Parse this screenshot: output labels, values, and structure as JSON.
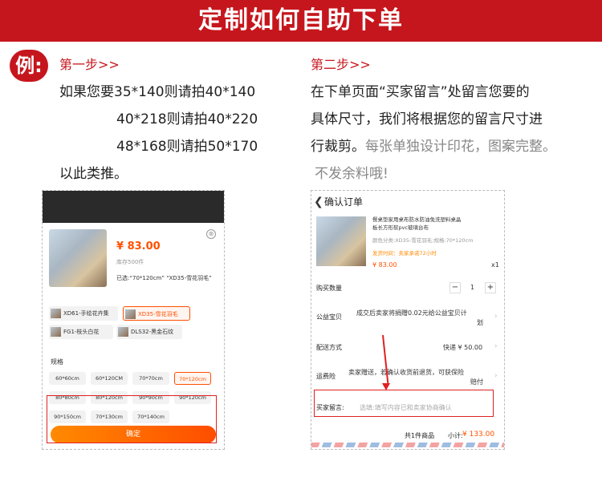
{
  "banner": {
    "title": "定制如何自助下单"
  },
  "example_badge": "例:",
  "step1": {
    "title": "第一步>>",
    "lines": [
      "如果您要35*140则请拍40*140",
      "40*218则请拍40*220",
      "48*168则请拍50*170",
      "以此类推。"
    ]
  },
  "step2": {
    "title": "第二步>>",
    "line1": "在下单页面“买家留言”处留言您要的",
    "line2": "具体尺寸，我们将根据您的留言尺寸进",
    "line3_main": "行裁剪。",
    "line3_grey": "每张单独设计印花，图案完整。",
    "line4": "不发余料哦!"
  },
  "left_phone": {
    "price": "¥ 83.00",
    "stock": "库存500件",
    "selected": "已选:“70*120cm” “XD35-雪花羽毛”",
    "close_icon": "⊗",
    "styles": [
      "XD61-手绘花卉集",
      "XD35-雪花羽毛",
      "FG1-枝头白花",
      "DLS32-黑金石纹"
    ],
    "spec_label": "规格",
    "sizes": [
      "60*60cm",
      "60*120CM",
      "70*70cm",
      "70*120cm",
      "80*80cm",
      "80*120cm",
      "90*90cm",
      "90*120cm",
      "90*150cm",
      "70*130cm",
      "70*140cm"
    ],
    "confirm": "确定"
  },
  "right_phone": {
    "header": "确认订单",
    "back_icon": "❮",
    "product_title_1": "餐桌垫家用桌布防水防油免洗塑料桌晶",
    "product_title_2": "板长方形软pvc玻璃台布",
    "attributes": "颜色分类:XD35-雪花羽毛;规格:70*120cm",
    "ship_note": "发货时间：卖家承诺72小时",
    "price": "¥ 83.00",
    "qty_x": "x1",
    "buy_qty_label": "购买数量",
    "qty_minus": "−",
    "qty_value": "1",
    "qty_plus": "+",
    "charity_label": "公益宝贝",
    "charity_text_1": "成交后卖家将捐赠0.02元给公益宝贝计",
    "charity_text_2": "划",
    "ship_label": "配送方式",
    "ship_value": "快递 ¥ 50.00",
    "insurance_label": "运费险",
    "insurance_text_1": "卖家赠送，若确认收货前退货，可获保险",
    "insurance_text_2": "赔付",
    "message_label": "买家留言:",
    "message_placeholder": "选填:填写内容已和卖家协商确认",
    "footer_count": "共1件商品",
    "footer_subtotal_label": "小计:",
    "footer_subtotal": "¥ 133.00"
  },
  "colors": {
    "brand_red": "#c6161d",
    "price_orange": "#ff5000"
  }
}
